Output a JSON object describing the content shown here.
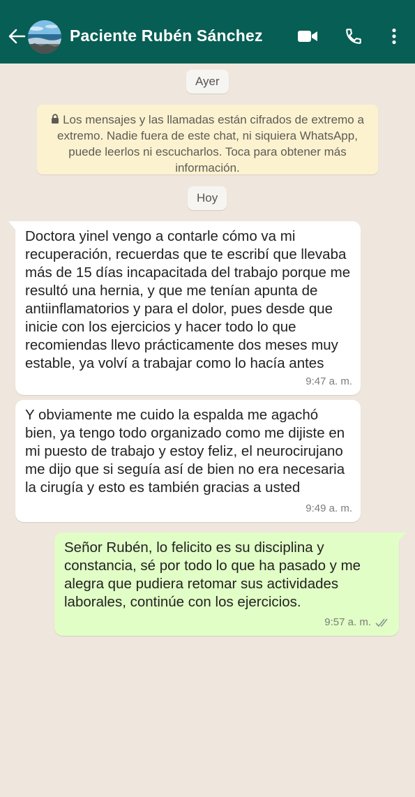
{
  "header": {
    "title": "Paciente Rubén Sánchez",
    "bg_color": "#075e54",
    "icons": [
      "back-arrow-icon",
      "video-call-icon",
      "phone-icon",
      "more-options-icon"
    ]
  },
  "date_separators": {
    "yesterday": "Ayer",
    "today": "Hoy"
  },
  "encryption_notice": {
    "text": "Los mensajes y las llamadas están cifrados de extremo a extremo. Nadie fuera de este chat, ni siquiera WhatsApp, puede leerlos ni escucharlos. Toca para obtener más información.",
    "icon": "lock-icon",
    "bg_color": "#fdf2cf"
  },
  "messages": [
    {
      "direction": "incoming",
      "text": "Doctora yinel vengo a contarle cómo va mi recuperación, recuerdas que te escribí que llevaba más de 15 días incapacitada del trabajo porque me resultó una hernia, y que me tenían apunta de antiinflamatorios y para el dolor, pues desde que inicie con los ejercicios y hacer todo lo que recomiendas llevo prácticamente dos meses muy estable, ya volví a trabajar como lo hacía antes",
      "time": "9:47 a. m."
    },
    {
      "direction": "incoming",
      "text": "Y obviamente me cuido la espalda me agachó bien, ya tengo todo organizado como me dijiste en mi puesto de trabajo y estoy feliz, el neurocirujano me dijo que si seguía así de bien no era necesaria la cirugía y esto es también gracias a usted",
      "time": "9:49 a. m."
    },
    {
      "direction": "outgoing",
      "text": "Señor Rubén, lo felicito es su disciplina y constancia, sé por todo lo que ha pasado y me alegra que pudiera retomar sus actividades laborales, continúe con los ejercicios.",
      "time": "9:57 a. m.",
      "status_icon": "double-check-icon",
      "bg_color": "#e1fec6"
    }
  ],
  "chat_background_color": "#efe7dd"
}
